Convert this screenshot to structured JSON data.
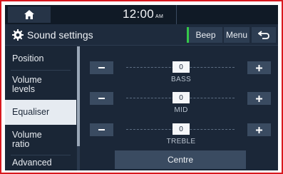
{
  "status_bar": {
    "time": "12:00",
    "ampm": "AM"
  },
  "title_bar": {
    "title": "Sound settings",
    "beep_label": "Beep",
    "menu_label": "Menu"
  },
  "side_menu": {
    "items": [
      {
        "label": "Position"
      },
      {
        "label": "Volume levels"
      },
      {
        "label": "Equaliser",
        "selected": true
      },
      {
        "label": "Volume ratio"
      },
      {
        "label": "Advanced"
      }
    ]
  },
  "equaliser": {
    "bands": [
      {
        "label": "BASS",
        "value": "0"
      },
      {
        "label": "MID",
        "value": "0"
      },
      {
        "label": "TREBLE",
        "value": "0"
      }
    ],
    "centre_label": "Centre"
  },
  "colors": {
    "screen_bg": "#1b2738",
    "selected_item": "#e6ebf1",
    "beep_indicator": "#35c84a",
    "outer_border": "#d8181e"
  }
}
